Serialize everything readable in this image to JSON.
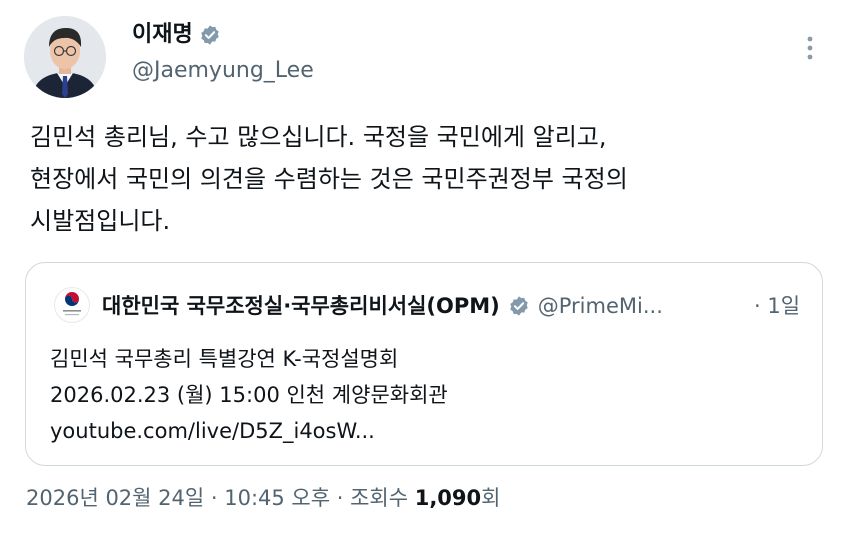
{
  "author": {
    "display_name": "이재명",
    "handle": "@Jaemyung_Lee",
    "verified_badge_icon": "verified-check-icon",
    "badge_color": "#829aab"
  },
  "tweet": {
    "lines": [
      "김민석 총리님, 수고 많으십니다. 국정을 국민에게 알리고,",
      "현장에서 국민의 의견을 수렴하는 것은 국민주권정부 국정의",
      "시발점입니다."
    ]
  },
  "quote": {
    "name": "대한민국 국무조정실·국무총리비서실(OPM)",
    "handle": "@PrimeMi...",
    "time": "· 1일",
    "lines": [
      "김민석 국무총리 특별강연 K-국정설명회",
      "2026.02.23 (월) 15:00 인천 계양문화회관",
      "youtube.com/live/D5Z_i4osW..."
    ]
  },
  "meta": {
    "timestamp": "2026년 02월 24일 · 10:45 오후 · 조회수 ",
    "views": "1,090",
    "views_suffix": "회"
  },
  "colors": {
    "text_primary": "#0f1419",
    "text_secondary": "#536471",
    "border": "#cfd9de"
  }
}
